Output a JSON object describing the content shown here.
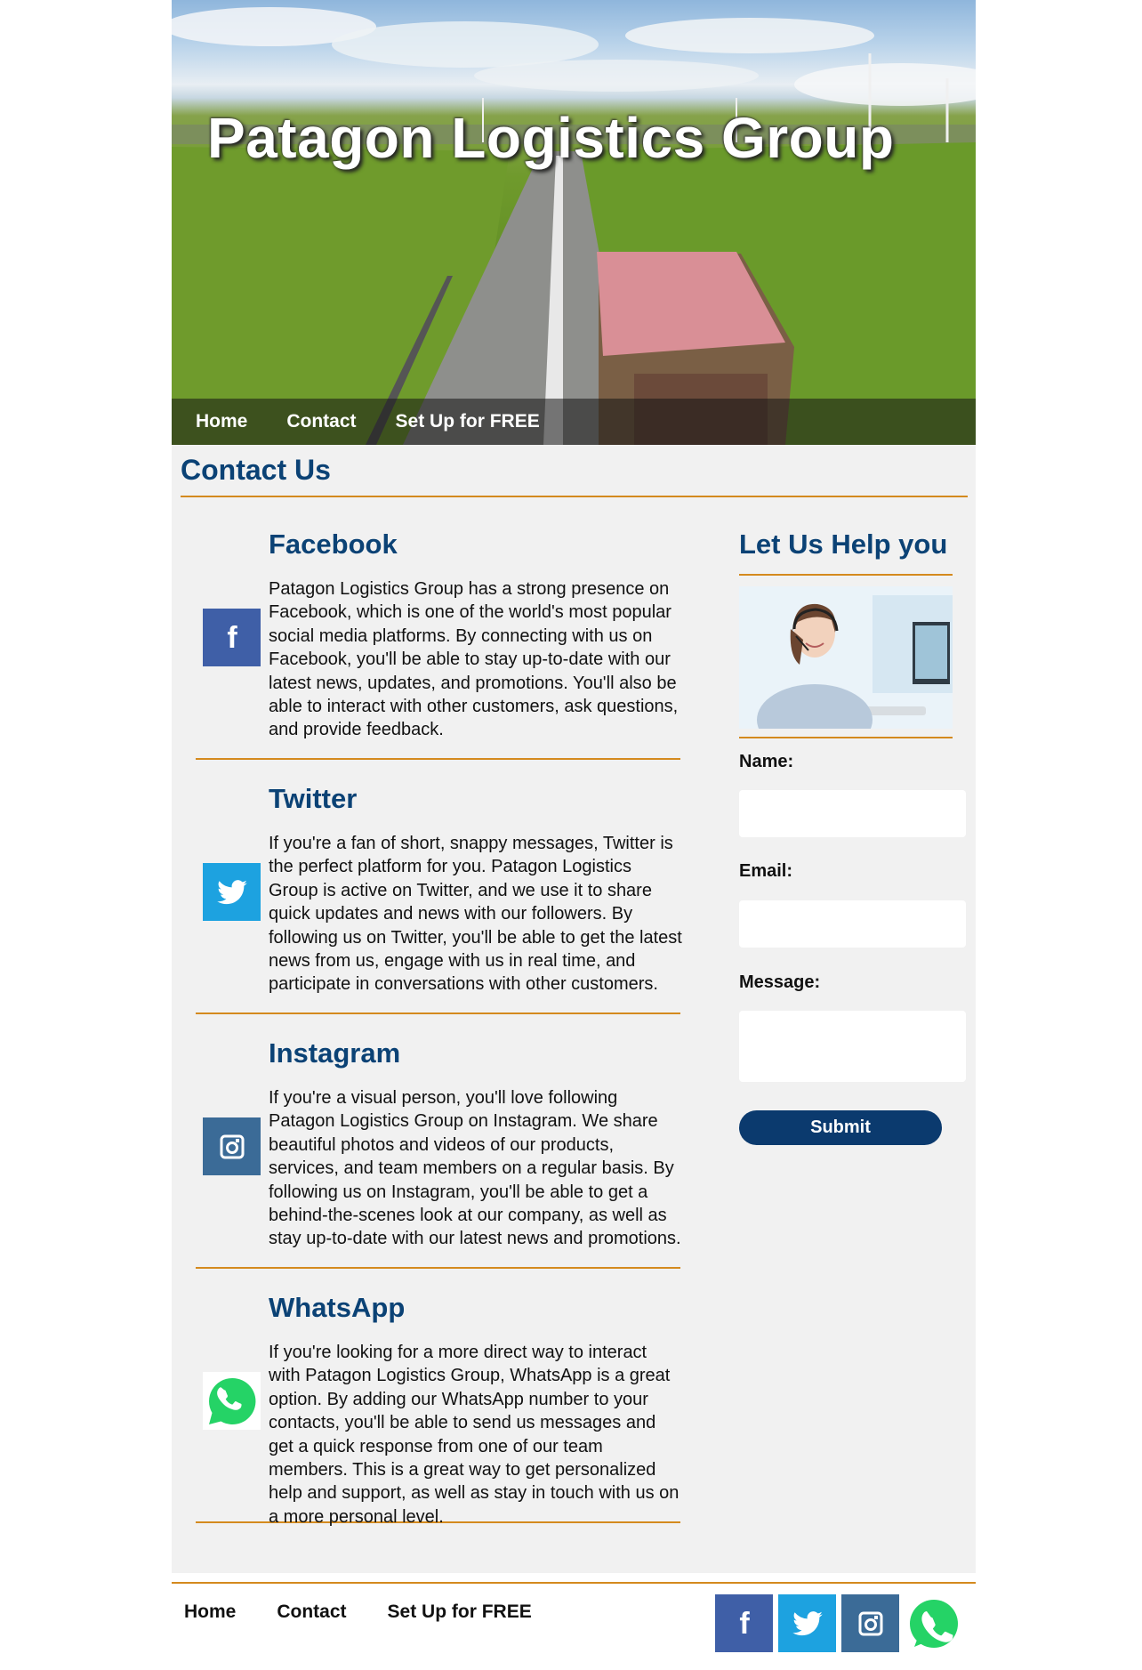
{
  "hero": {
    "title": "Patagon Logistics Group"
  },
  "nav": {
    "items": [
      "Home",
      "Contact",
      "Set Up for FREE"
    ]
  },
  "main": {
    "title": "Contact Us",
    "social": [
      {
        "name": "Facebook",
        "icon": "facebook-icon",
        "color": "#3f5fa7",
        "text": "Patagon Logistics Group has a strong presence on Facebook, which is one of the world's most popular social media platforms. By connecting with us on Facebook, you'll be able to stay up-to-date with our latest news, updates, and promotions. You'll also be able to interact with other customers, ask questions, and provide feedback."
      },
      {
        "name": "Twitter",
        "icon": "twitter-icon",
        "color": "#1da2e0",
        "text": "If you're a fan of short, snappy messages, Twitter is the perfect platform for you. Patagon Logistics Group is active on Twitter, and we use it to share quick updates and news with our followers. By following us on Twitter, you'll be able to get the latest news from us, engage with us in real time, and participate in conversations with other customers."
      },
      {
        "name": "Instagram",
        "icon": "instagram-icon",
        "color": "#3b6b97",
        "text": "If you're a visual person, you'll love following Patagon Logistics Group on Instagram. We share beautiful photos and videos of our products, services, and team members on a regular basis. By following us on Instagram, you'll be able to get a behind-the-scenes look at our company, as well as stay up-to-date with our latest news and promotions."
      },
      {
        "name": "WhatsApp",
        "icon": "whatsapp-icon",
        "color": "#25d366",
        "text": "If you're looking for a more direct way to interact with Patagon Logistics Group, WhatsApp is a great option. By adding our WhatsApp number to your contacts, you'll be able to send us messages and get a quick response from one of our team members. This is a great way to get personalized help and support, as well as stay in touch with us on a more personal level."
      }
    ]
  },
  "sidebar": {
    "title": "Let Us Help you",
    "form": {
      "name_label": "Name:",
      "email_label": "Email:",
      "message_label": "Message:",
      "submit_label": "Submit"
    }
  },
  "footer": {
    "nav": [
      "Home",
      "Contact",
      "Set Up for FREE"
    ],
    "icons": [
      "facebook-icon",
      "twitter-icon",
      "instagram-icon",
      "whatsapp-icon"
    ]
  },
  "colors": {
    "heading": "#0b4275",
    "accent_rule": "#d48a1e",
    "submit": "#0b3a6e"
  }
}
